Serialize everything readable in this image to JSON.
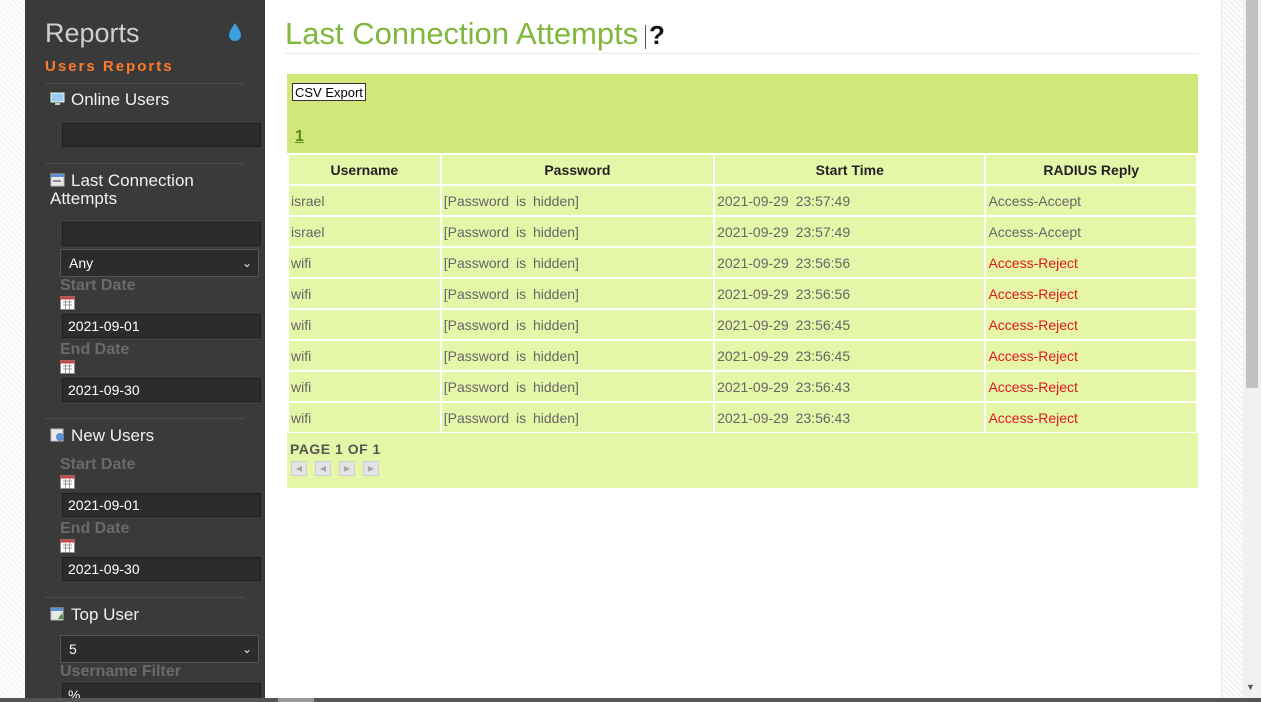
{
  "sidebar": {
    "title": "Reports",
    "subtitle": "Users Reports",
    "online_users": {
      "label": "Online Users",
      "input_value": ""
    },
    "last_attempts": {
      "label": "Last Connection Attempts",
      "input_value": "",
      "select_value": "Any",
      "start_label": "Start Date",
      "start_value": "2021-09-01",
      "end_label": "End Date",
      "end_value": "2021-09-30"
    },
    "new_users": {
      "label": "New Users",
      "start_label": "Start Date",
      "start_value": "2021-09-01",
      "end_label": "End Date",
      "end_value": "2021-09-30"
    },
    "top_user": {
      "label": "Top User",
      "select_value": "5",
      "filter_label": "Username Filter",
      "filter_value": "%"
    }
  },
  "main": {
    "title": "Last Connection Attempts",
    "help": "?",
    "csv_button": "CSV Export",
    "page_link": "1",
    "columns": [
      "Username",
      "Password",
      "Start Time",
      "RADIUS Reply"
    ],
    "rows": [
      {
        "username": "israel",
        "password": "[Password is hidden]",
        "start": "2021-09-29 23:57:49",
        "reply": "Access-Accept"
      },
      {
        "username": "israel",
        "password": "[Password is hidden]",
        "start": "2021-09-29 23:57:49",
        "reply": "Access-Accept"
      },
      {
        "username": "wifi",
        "password": "[Password is hidden]",
        "start": "2021-09-29 23:56:56",
        "reply": "Access-Reject"
      },
      {
        "username": "wifi",
        "password": "[Password is hidden]",
        "start": "2021-09-29 23:56:56",
        "reply": "Access-Reject"
      },
      {
        "username": "wifi",
        "password": "[Password is hidden]",
        "start": "2021-09-29 23:56:45",
        "reply": "Access-Reject"
      },
      {
        "username": "wifi",
        "password": "[Password is hidden]",
        "start": "2021-09-29 23:56:45",
        "reply": "Access-Reject"
      },
      {
        "username": "wifi",
        "password": "[Password is hidden]",
        "start": "2021-09-29 23:56:43",
        "reply": "Access-Reject"
      },
      {
        "username": "wifi",
        "password": "[Password is hidden]",
        "start": "2021-09-29 23:56:43",
        "reply": "Access-Reject"
      }
    ],
    "page_info": "PAGE 1 OF 1"
  },
  "colors": {
    "accent": "#7fb83c",
    "reject": "#e0181a",
    "sidebar": "#3a3a3a",
    "subtitle": "#ff7a2a",
    "panel": "#d2e779"
  }
}
